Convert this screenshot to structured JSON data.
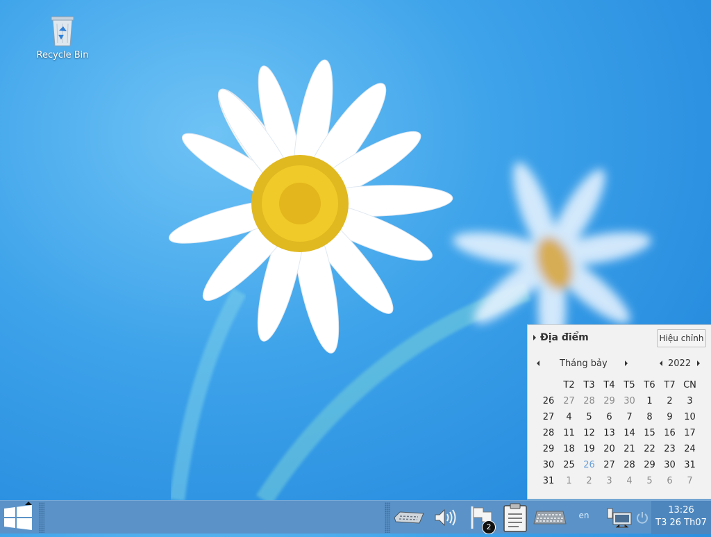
{
  "desktop": {
    "icons": [
      {
        "label": "Recycle Bin",
        "icon": "recycle-bin-icon"
      }
    ]
  },
  "calendar": {
    "locations_label": "Địa điểm",
    "edit_button": "Hiệu chỉnh",
    "month": "Tháng bảy",
    "year": "2022",
    "weekday_headers": [
      "T2",
      "T3",
      "T4",
      "T5",
      "T6",
      "T7",
      "CN"
    ],
    "weeks": [
      {
        "week": "26",
        "days": [
          "27",
          "28",
          "29",
          "30",
          "1",
          "2",
          "3"
        ]
      },
      {
        "week": "27",
        "days": [
          "4",
          "5",
          "6",
          "7",
          "8",
          "9",
          "10"
        ]
      },
      {
        "week": "28",
        "days": [
          "11",
          "12",
          "13",
          "14",
          "15",
          "16",
          "17"
        ]
      },
      {
        "week": "29",
        "days": [
          "18",
          "19",
          "20",
          "21",
          "22",
          "23",
          "24"
        ]
      },
      {
        "week": "30",
        "days": [
          "25",
          "26",
          "27",
          "28",
          "29",
          "30",
          "31"
        ]
      },
      {
        "week": "31",
        "days": [
          "1",
          "2",
          "3",
          "4",
          "5",
          "6",
          "7"
        ]
      }
    ],
    "today": "26"
  },
  "taskbar": {
    "start_icon": "windows-logo-icon",
    "tray": [
      "keyboard-icon",
      "volume-icon",
      "flag-icon",
      "clipboard-icon",
      "virtual-keyboard-icon",
      "network-icon",
      "power-icon"
    ],
    "notification_count": "2",
    "language": "en",
    "time": "13:26",
    "date": "T3 26 Th07"
  },
  "colors": {
    "taskbar": "#5b93c8",
    "today": "#6aa0d8"
  }
}
